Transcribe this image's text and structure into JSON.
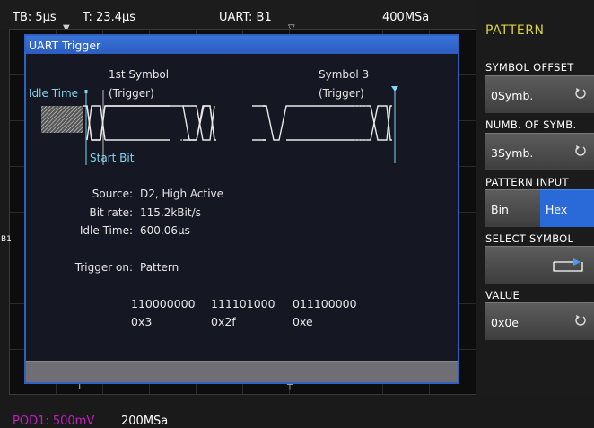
{
  "topbar": {
    "timebase": "TB: 5µs",
    "trigger_time": "T: 23.4µs",
    "trigger_source": "UART: B1",
    "sample_rate": "400MSa"
  },
  "dialog": {
    "title": "UART Trigger",
    "diagram": {
      "idle_time_label": "Idle Time",
      "first_symbol_label": "1st Symbol",
      "first_symbol_sub": "(Trigger)",
      "symbol3_label": "Symbol 3",
      "symbol3_sub": "(Trigger)",
      "start_bit_label": "Start Bit"
    },
    "source_label": "Source:",
    "source_value": "D2, High Active",
    "bitrate_label": "Bit rate:",
    "bitrate_value": "115.2kBit/s",
    "idle_label": "Idle Time:",
    "idle_value": "600.06µs",
    "trigger_on_label": "Trigger on:",
    "trigger_on_value": "Pattern",
    "pattern_bits": [
      "110000000",
      "111101000",
      "011100000"
    ],
    "pattern_hex": [
      "0x3",
      "0x2f",
      "0xe"
    ]
  },
  "bus_label": "B1",
  "bottom": {
    "pod_label": "POD1: 500mV",
    "pod_color": "#c020c0",
    "rate": "200MSa"
  },
  "side": {
    "title": "PATTERN",
    "title_color": "#d8d040",
    "symbol_offset_label": "SYMBOL OFFSET",
    "symbol_offset_value": "0Symb.",
    "numb_symb_label": "NUMB. OF SYMB.",
    "numb_symb_value": "3Symb.",
    "pattern_input_label": "PATTERN INPUT",
    "pattern_input_options": [
      "Bin",
      "Hex"
    ],
    "pattern_input_selected": "Hex",
    "select_symbol_label": "SELECT SYMBOL",
    "value_label": "VALUE",
    "value_value": "0x0e",
    "accent": "#2a6ad8"
  }
}
